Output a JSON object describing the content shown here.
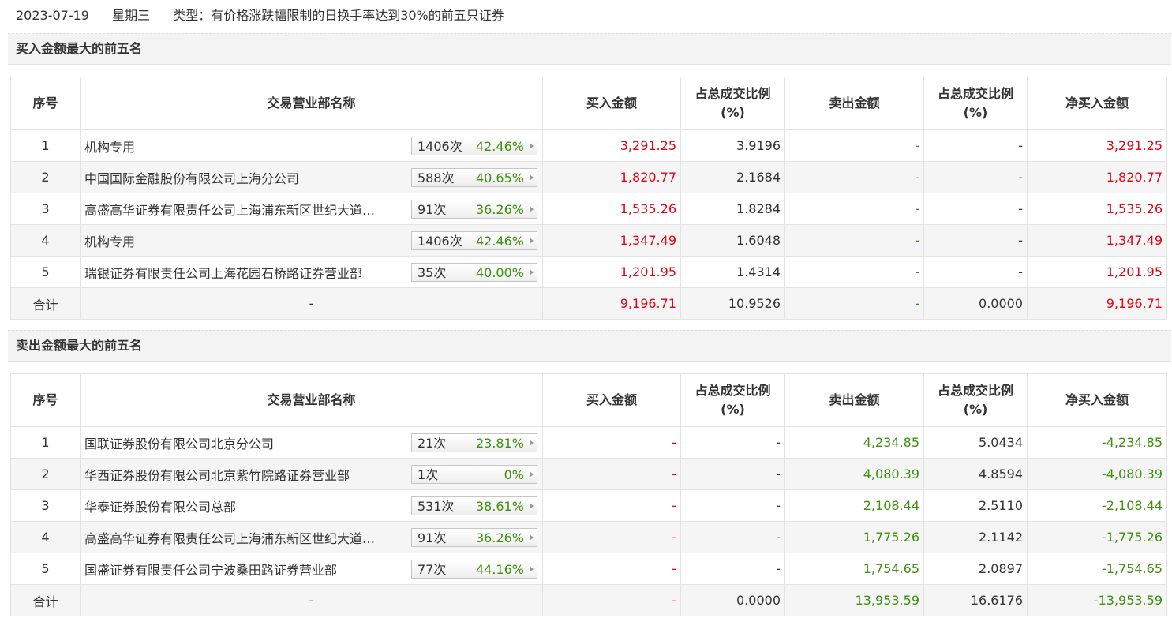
{
  "header": {
    "date": "2023-07-19",
    "weekday": "星期三",
    "type": "类型：有价格涨跌幅限制的日换手率达到30%的前五只证券"
  },
  "columns": {
    "seq": "序号",
    "name": "交易营业部名称",
    "buy": "买入金额",
    "buy_pct": "占总成交比例(%)",
    "sell": "卖出金额",
    "sell_pct": "占总成交比例(%)",
    "net": "净买入金额"
  },
  "buy_section": {
    "title": "买入金额最大的前五名",
    "rows": [
      {
        "seq": "1",
        "name": "机构专用",
        "count": "1406次",
        "rate": "42.46%",
        "buy": "3,291.25",
        "buy_pct": "3.9196",
        "sell": "-",
        "sell_pct": "-",
        "net": "3,291.25"
      },
      {
        "seq": "2",
        "name": "中国国际金融股份有限公司上海分公司",
        "count": "588次",
        "rate": "40.65%",
        "buy": "1,820.77",
        "buy_pct": "2.1684",
        "sell": "-",
        "sell_pct": "-",
        "net": "1,820.77"
      },
      {
        "seq": "3",
        "name": "高盛高华证券有限责任公司上海浦东新区世纪大道…",
        "count": "91次",
        "rate": "36.26%",
        "buy": "1,535.26",
        "buy_pct": "1.8284",
        "sell": "-",
        "sell_pct": "-",
        "net": "1,535.26"
      },
      {
        "seq": "4",
        "name": "机构专用",
        "count": "1406次",
        "rate": "42.46%",
        "buy": "1,347.49",
        "buy_pct": "1.6048",
        "sell": "-",
        "sell_pct": "-",
        "net": "1,347.49"
      },
      {
        "seq": "5",
        "name": "瑞银证券有限责任公司上海花园石桥路证券营业部",
        "count": "35次",
        "rate": "40.00%",
        "buy": "1,201.95",
        "buy_pct": "1.4314",
        "sell": "-",
        "sell_pct": "-",
        "net": "1,201.95"
      }
    ],
    "total": {
      "label": "合计",
      "name": "-",
      "buy": "9,196.71",
      "buy_pct": "10.9526",
      "sell": "-",
      "sell_pct": "0.0000",
      "net": "9,196.71"
    }
  },
  "sell_section": {
    "title": "卖出金额最大的前五名",
    "rows": [
      {
        "seq": "1",
        "name": "国联证券股份有限公司北京分公司",
        "count": "21次",
        "rate": "23.81%",
        "buy": "-",
        "buy_pct": "-",
        "sell": "4,234.85",
        "sell_pct": "5.0434",
        "net": "-4,234.85"
      },
      {
        "seq": "2",
        "name": "华西证券股份有限公司北京紫竹院路证券营业部",
        "count": "1次",
        "rate": "0%",
        "buy": "-",
        "buy_pct": "-",
        "sell": "4,080.39",
        "sell_pct": "4.8594",
        "net": "-4,080.39"
      },
      {
        "seq": "3",
        "name": "华泰证券股份有限公司总部",
        "count": "531次",
        "rate": "38.61%",
        "buy": "-",
        "buy_pct": "-",
        "sell": "2,108.44",
        "sell_pct": "2.5110",
        "net": "-2,108.44"
      },
      {
        "seq": "4",
        "name": "高盛高华证券有限责任公司上海浦东新区世纪大道…",
        "count": "91次",
        "rate": "36.26%",
        "buy": "-",
        "buy_pct": "-",
        "sell": "1,775.26",
        "sell_pct": "2.1142",
        "net": "-1,775.26"
      },
      {
        "seq": "5",
        "name": "国盛证券有限责任公司宁波桑田路证券营业部",
        "count": "77次",
        "rate": "44.16%",
        "buy": "-",
        "buy_pct": "-",
        "sell": "1,754.65",
        "sell_pct": "2.0897",
        "net": "-1,754.65"
      }
    ],
    "total": {
      "label": "合计",
      "name": "-",
      "buy": "-",
      "buy_pct": "0.0000",
      "sell": "13,953.59",
      "sell_pct": "16.6176",
      "net": "-13,953.59"
    }
  },
  "colors": {
    "up": "#e60012",
    "down": "#3f8f10"
  }
}
